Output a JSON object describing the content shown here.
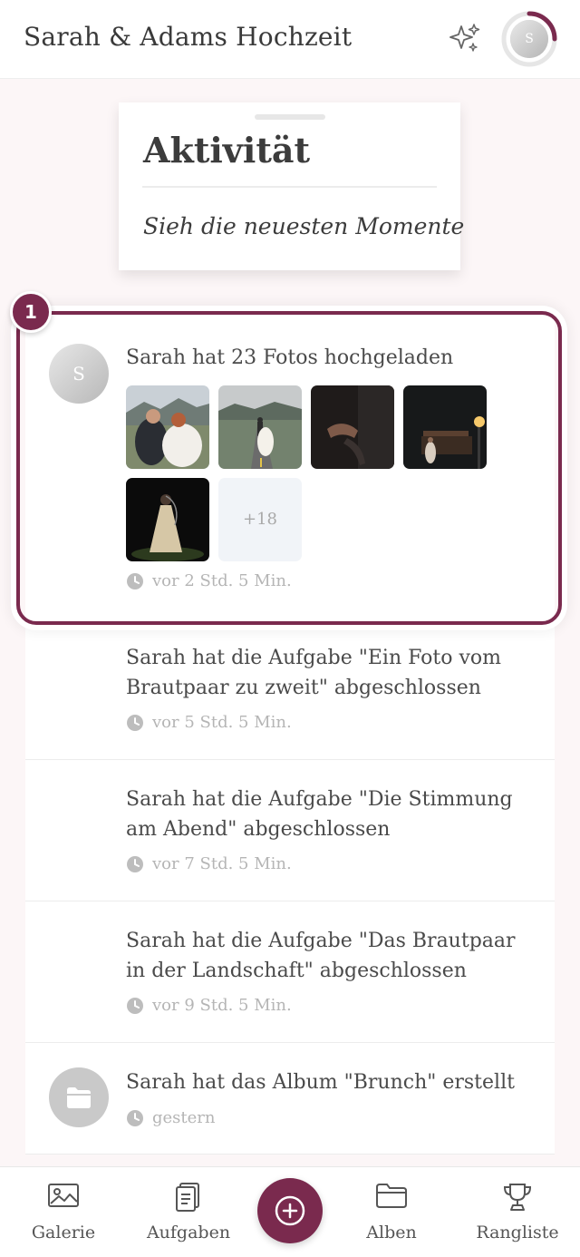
{
  "header": {
    "title": "Sarah & Adams Hochzeit",
    "avatar_initial": "S",
    "accent_color": "#7a2a4e",
    "icons": [
      "sparkle-icon",
      "profile-avatar"
    ]
  },
  "title_card": {
    "heading": "Aktivität",
    "subtitle": "Sieh die neuesten Momente"
  },
  "tour": {
    "step_number": "1"
  },
  "feed": {
    "items": [
      {
        "text": "Sarah hat 23 Fotos hochgeladen",
        "avatar_initial": "S",
        "more_count": "+18",
        "time": "vor 2 Std. 5 Min."
      },
      {
        "text": "Sarah hat die Aufgabe \"Ein Foto vom Brautpaar zu zweit\" abgeschlossen",
        "time": "vor 5 Std. 5 Min."
      },
      {
        "text": "Sarah hat die Aufgabe \"Die Stimmung am Abend\" abgeschlossen",
        "time": "vor 7 Std. 5 Min."
      },
      {
        "text": "Sarah hat die Aufgabe \"Das Brautpaar in der Landschaft\" abgeschlossen",
        "time": "vor 9 Std. 5 Min."
      },
      {
        "text": "Sarah hat das Album \"Brunch\" erstellt",
        "time": "gestern"
      }
    ]
  },
  "bottom_nav": {
    "items": [
      {
        "label": "Galerie",
        "icon": "gallery-icon"
      },
      {
        "label": "Aufgaben",
        "icon": "tasks-icon"
      },
      {
        "label": "Alben",
        "icon": "folder-icon"
      },
      {
        "label": "Rangliste",
        "icon": "trophy-icon"
      }
    ],
    "add_icon": "plus-icon"
  }
}
